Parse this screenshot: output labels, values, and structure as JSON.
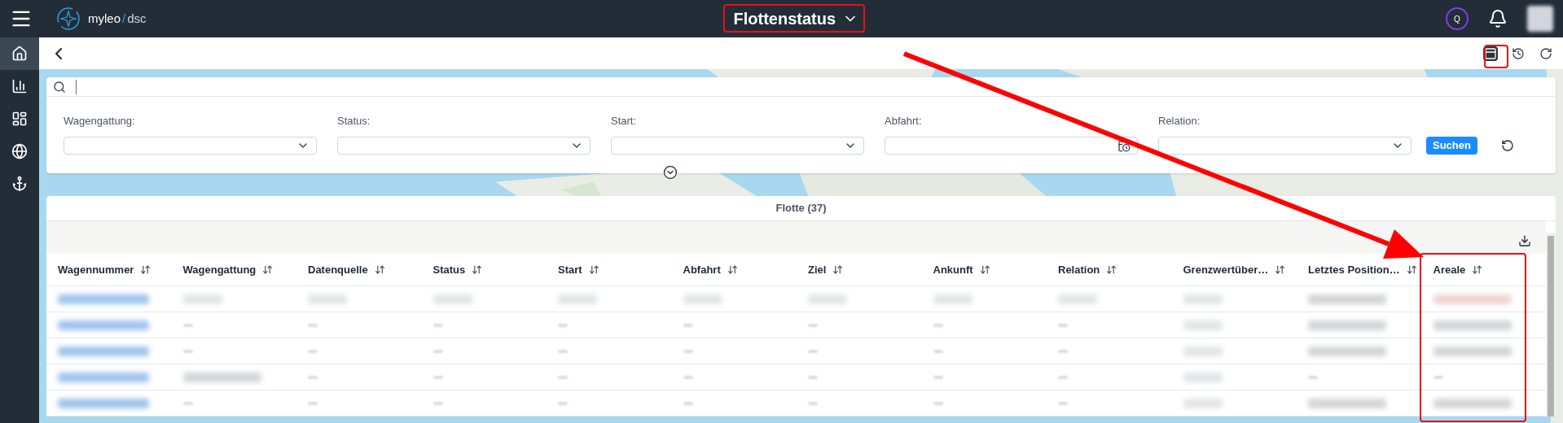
{
  "top_bar": {
    "brand": "myleo",
    "brand_separator": "/",
    "brand_suffix": "dsc",
    "title": "Flottenstatus",
    "user_initial": "Q"
  },
  "sidebar": {
    "items": [
      {
        "kind": "home",
        "selected": true
      },
      {
        "kind": "chart",
        "selected": false
      },
      {
        "kind": "dashboard",
        "selected": false
      },
      {
        "kind": "globe",
        "selected": false
      },
      {
        "kind": "anchor",
        "selected": false
      }
    ]
  },
  "toolbar": {
    "actions": [
      {
        "kind": "table",
        "selected": true
      },
      {
        "kind": "history",
        "selected": false
      },
      {
        "kind": "refresh",
        "selected": false
      }
    ]
  },
  "filters": {
    "fields": [
      {
        "label": "Wagengattung:",
        "kind": "select"
      },
      {
        "label": "Status:",
        "kind": "select"
      },
      {
        "label": "Start:",
        "kind": "select"
      },
      {
        "label": "Abfahrt:",
        "kind": "date"
      },
      {
        "label": "Relation:",
        "kind": "select"
      }
    ],
    "search_button": "Suchen"
  },
  "table": {
    "title": "Flotte (37)",
    "columns": [
      "Wagennummer",
      "Wagengattung",
      "Datenquelle",
      "Status",
      "Start",
      "Abfahrt",
      "Ziel",
      "Ankunft",
      "Relation",
      "Grenzwertüber…",
      "Letztes Position…",
      "Areale"
    ],
    "rows": [
      {
        "cells": [
          {
            "kind": "link"
          },
          {
            "kind": "short"
          },
          {
            "kind": "short"
          },
          {
            "kind": "short"
          },
          {
            "kind": "short"
          },
          {
            "kind": "short"
          },
          {
            "kind": "short"
          },
          {
            "kind": "short"
          },
          {
            "kind": "short"
          },
          {
            "kind": "short"
          },
          {
            "kind": "long"
          },
          {
            "kind": "marked"
          }
        ]
      },
      {
        "cells": [
          {
            "kind": "link"
          },
          {
            "kind": "dash"
          },
          {
            "kind": "dash"
          },
          {
            "kind": "dash"
          },
          {
            "kind": "dash"
          },
          {
            "kind": "dash"
          },
          {
            "kind": "dash"
          },
          {
            "kind": "dash"
          },
          {
            "kind": "dash"
          },
          {
            "kind": "short"
          },
          {
            "kind": "long"
          },
          {
            "kind": "long"
          }
        ]
      },
      {
        "cells": [
          {
            "kind": "link"
          },
          {
            "kind": "dash"
          },
          {
            "kind": "dash"
          },
          {
            "kind": "dash"
          },
          {
            "kind": "dash"
          },
          {
            "kind": "dash"
          },
          {
            "kind": "dash"
          },
          {
            "kind": "dash"
          },
          {
            "kind": "dash"
          },
          {
            "kind": "short"
          },
          {
            "kind": "long"
          },
          {
            "kind": "long"
          }
        ]
      },
      {
        "cells": [
          {
            "kind": "link"
          },
          {
            "kind": "long"
          },
          {
            "kind": "dash"
          },
          {
            "kind": "dash"
          },
          {
            "kind": "dash"
          },
          {
            "kind": "dash"
          },
          {
            "kind": "dash"
          },
          {
            "kind": "dash"
          },
          {
            "kind": "dash"
          },
          {
            "kind": "short"
          },
          {
            "kind": "dash"
          },
          {
            "kind": "dash"
          }
        ]
      },
      {
        "cells": [
          {
            "kind": "link"
          },
          {
            "kind": "dash"
          },
          {
            "kind": "dash"
          },
          {
            "kind": "dash"
          },
          {
            "kind": "dash"
          },
          {
            "kind": "dash"
          },
          {
            "kind": "dash"
          },
          {
            "kind": "dash"
          },
          {
            "kind": "dash"
          },
          {
            "kind": "short"
          },
          {
            "kind": "long"
          },
          {
            "kind": "long"
          }
        ]
      }
    ]
  },
  "annotations": {
    "highlights": [
      {
        "kind": "title"
      },
      {
        "kind": "toolbar"
      },
      {
        "kind": "column"
      }
    ],
    "arrow": true
  }
}
